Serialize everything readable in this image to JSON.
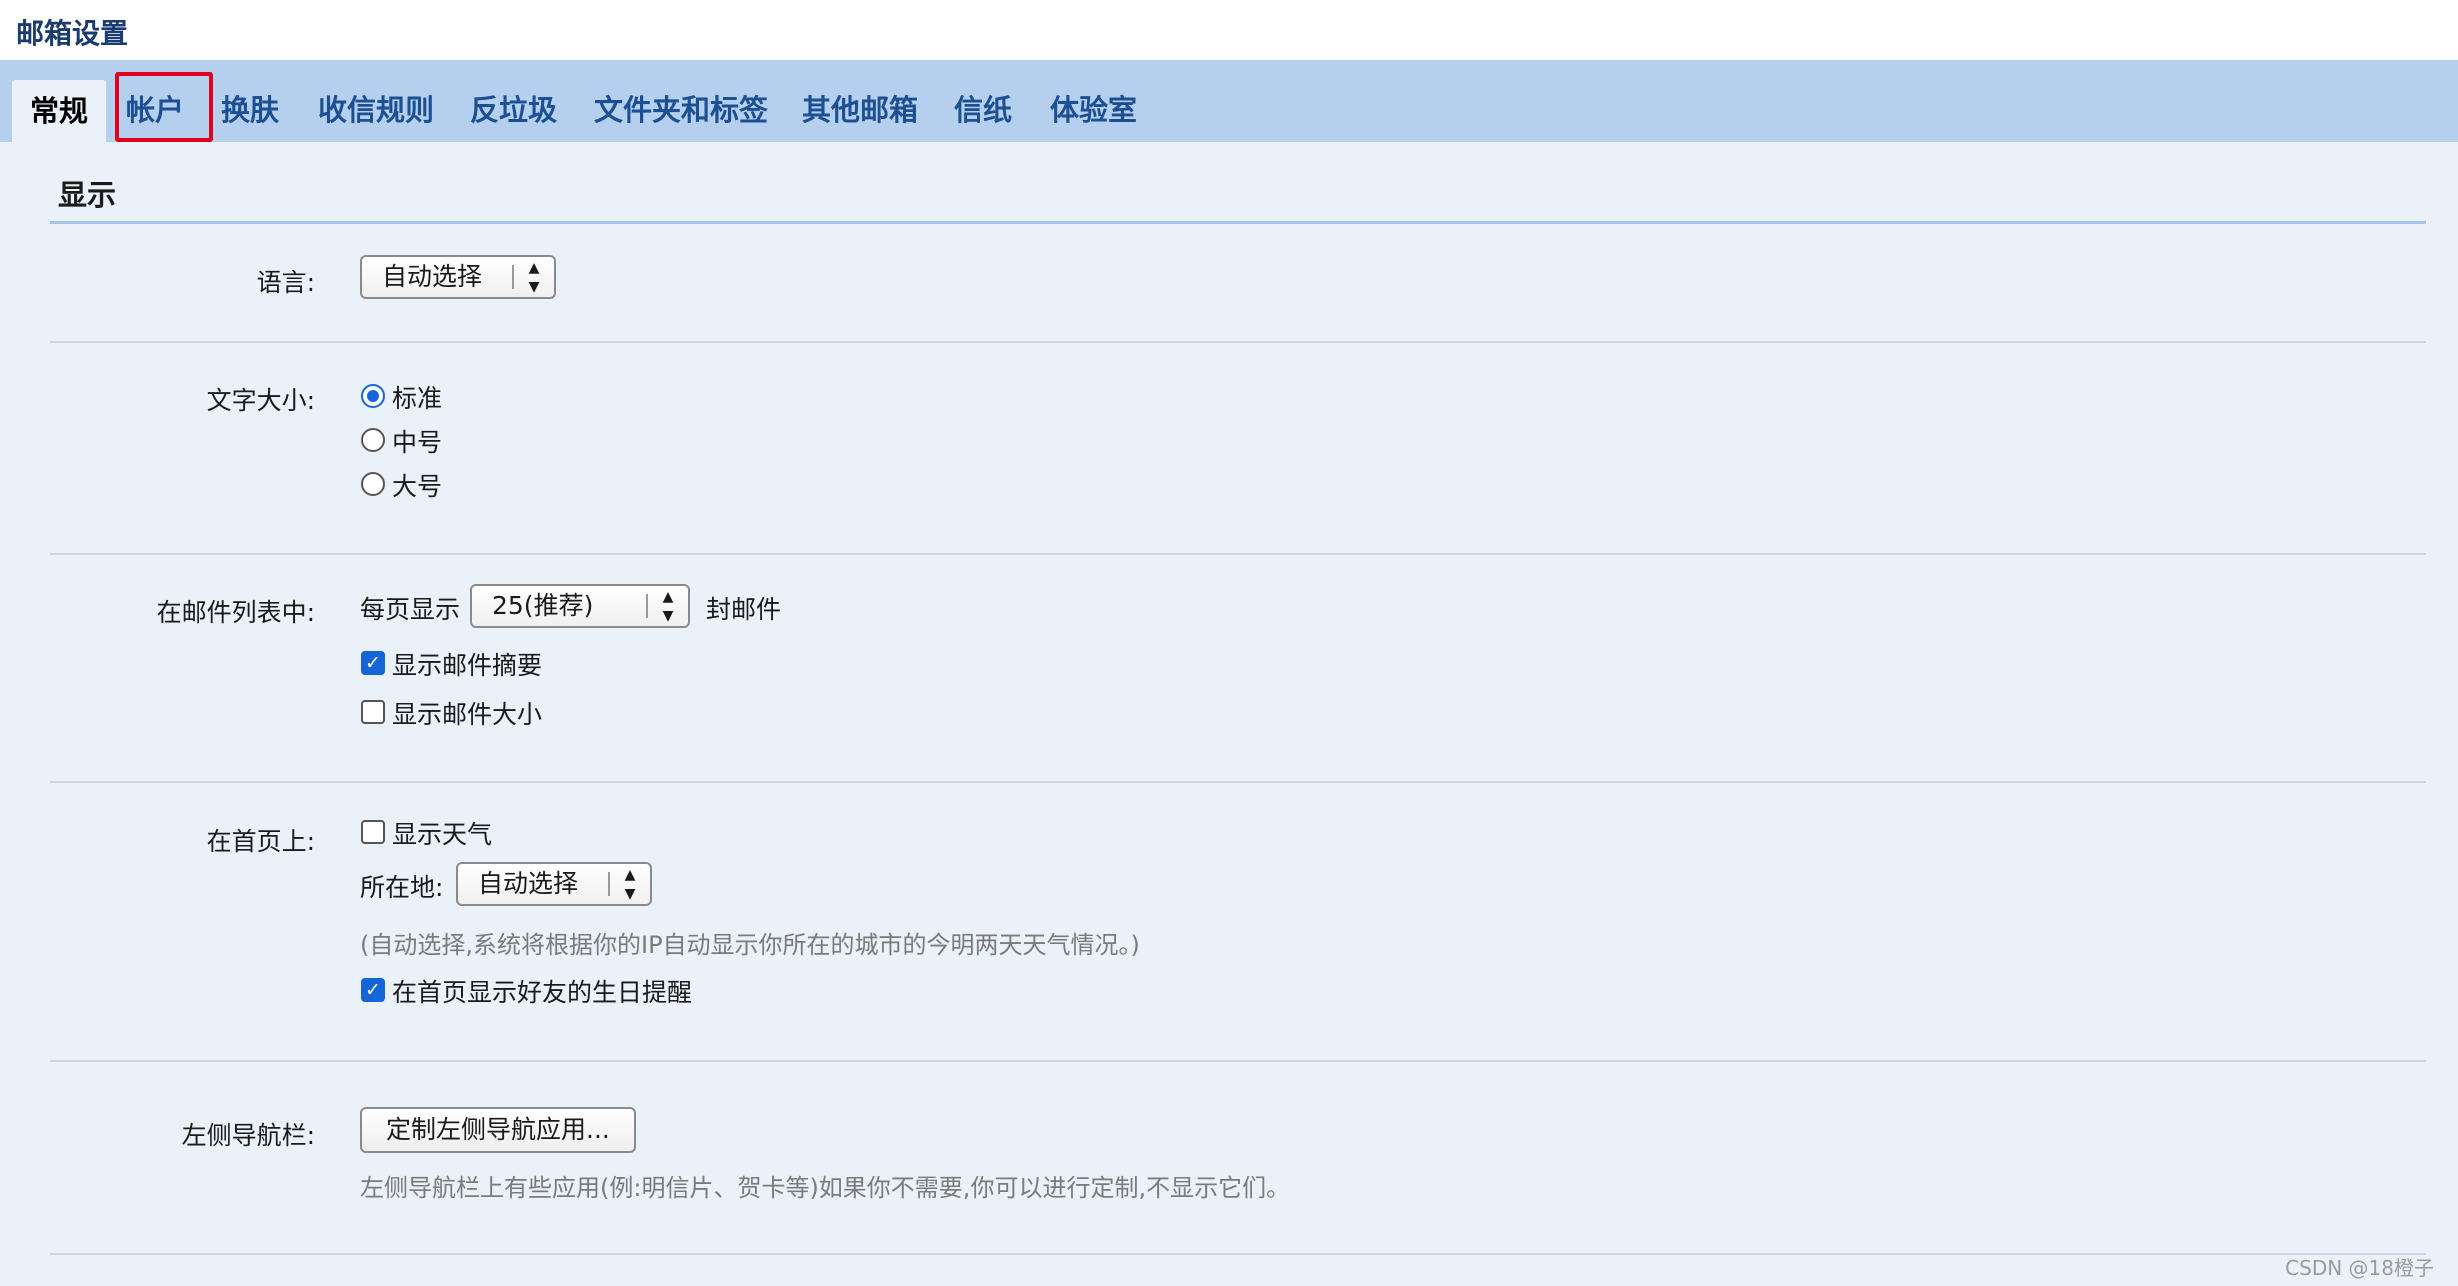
{
  "page": {
    "title": "邮箱设置",
    "accent": "#1565d8",
    "tab_bg": "#b5d0ee",
    "highlight": "#e0001b"
  },
  "tabs": [
    "常规",
    "帐户",
    "换肤",
    "收信规则",
    "反垃圾",
    "文件夹和标签",
    "其他邮箱",
    "信纸",
    "体验室"
  ],
  "section": {
    "title": "显示"
  },
  "language": {
    "label": "语言:",
    "value": "自动选择"
  },
  "font_size": {
    "label": "文字大小:",
    "options": [
      "标准",
      "中号",
      "大号"
    ],
    "selected": "标准"
  },
  "mail_list": {
    "label": "在邮件列表中:",
    "per_page_prefix": "每页显示",
    "per_page_value": "25(推荐)",
    "per_page_suffix": "封邮件",
    "show_summary": "显示邮件摘要",
    "show_summary_checked": true,
    "show_size": "显示邮件大小",
    "show_size_checked": false
  },
  "homepage": {
    "label": "在首页上:",
    "show_weather": "显示天气",
    "show_weather_checked": false,
    "location_label": "所在地:",
    "location_value": "自动选择",
    "location_hint": "(自动选择,系统将根据你的IP自动显示你所在的城市的今明两天天气情况。)",
    "birthday": "在首页显示好友的生日提醒",
    "birthday_checked": true
  },
  "left_nav": {
    "label": "左侧导航栏:",
    "button": "定制左侧导航应用...",
    "hint": "左侧导航栏上有些应用(例:明信片、贺卡等)如果你不需要,你可以进行定制,不显示它们。"
  },
  "watermark": "CSDN @18橙子"
}
